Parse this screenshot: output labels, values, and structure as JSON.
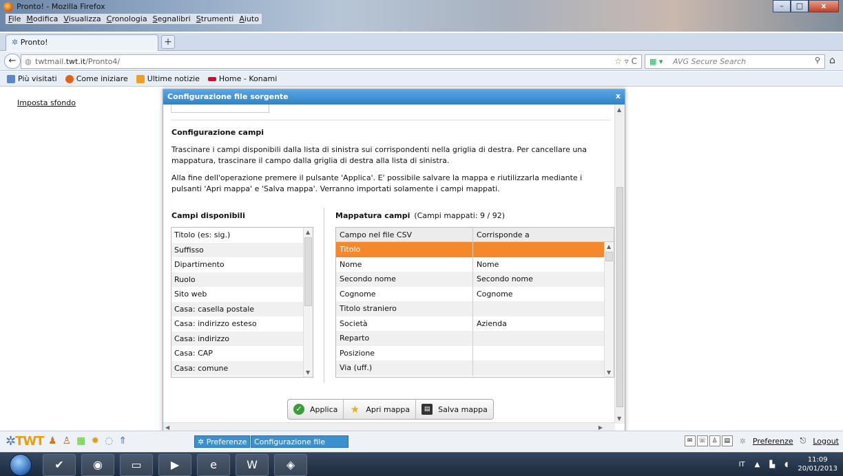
{
  "window": {
    "title": "Pronto! - Mozilla Firefox",
    "menu": [
      "File",
      "Modifica",
      "Visualizza",
      "Cronologia",
      "Segnalibri",
      "Strumenti",
      "Aiuto"
    ],
    "controls": {
      "minimize": "–",
      "maximize": "□",
      "close": "x"
    }
  },
  "browser": {
    "tab_title": "Pronto!",
    "new_tab": "+",
    "url_host": "twtmail.",
    "url_domain": "twt.it",
    "url_path": "/Pronto4/",
    "search_placeholder": "AVG Secure Search",
    "bookmarks": [
      "Più visitati",
      "Come iniziare",
      "Ultime notizie",
      "Home - Konami"
    ]
  },
  "page": {
    "imposta_sfondo": "Imposta sfondo"
  },
  "modal": {
    "title": "Configurazione file sorgente",
    "close": "x",
    "section_title": "Configurazione campi",
    "para1": "Trascinare i campi disponibili dalla lista di sinistra sui corrispondenti nella griglia di destra. Per cancellare una mappatura, trascinare il campo dalla griglia di destra alla lista di sinistra.",
    "para2": "Alla fine dell'operazione premere il pulsante 'Applica'. E' possibile salvare la mappa e riutilizzarla mediante i pulsanti 'Apri mappa' e 'Salva mappa'. Verranno importati solamente i campi mappati.",
    "available_title": "Campi disponibili",
    "available_fields": [
      "Titolo (es: sig.)",
      "Suffisso",
      "Dipartimento",
      "Ruolo",
      "Sito web",
      "Casa: casella postale",
      "Casa: indirizzo esteso",
      "Casa: indirizzo",
      "Casa: CAP",
      "Casa: comune"
    ],
    "mapping_title": "Mappatura campi",
    "mapping_count": "(Campi mappati: 9   / 92)",
    "grid_headers": [
      "Campo nel file CSV",
      "Corrisponde a"
    ],
    "grid_rows": [
      [
        "Titolo",
        ""
      ],
      [
        "Nome",
        "Nome"
      ],
      [
        "Secondo nome",
        "Secondo nome"
      ],
      [
        "Cognome",
        "Cognome"
      ],
      [
        "Titolo straniero",
        ""
      ],
      [
        "Società",
        "Azienda"
      ],
      [
        "Reparto",
        ""
      ],
      [
        "Posizione",
        ""
      ],
      [
        "Via (uff.)",
        ""
      ]
    ],
    "buttons": {
      "apply": "Applica",
      "open_map": "Apri mappa",
      "save_map": "Salva mappa"
    }
  },
  "twt_bar": {
    "logo": "TWT",
    "tab_preferenze": "✲ Preferenze",
    "tab_config": "Configurazione file sorg...",
    "link_preferenze": "Preferenze",
    "link_logout": "Logout"
  },
  "taskbar": {
    "lang": "IT",
    "time": "11:09",
    "date": "20/01/2013"
  },
  "colors": {
    "accent_modal": "#2f82c9",
    "selected_row": "#f5882a",
    "twt_logo": "#e8a010"
  }
}
